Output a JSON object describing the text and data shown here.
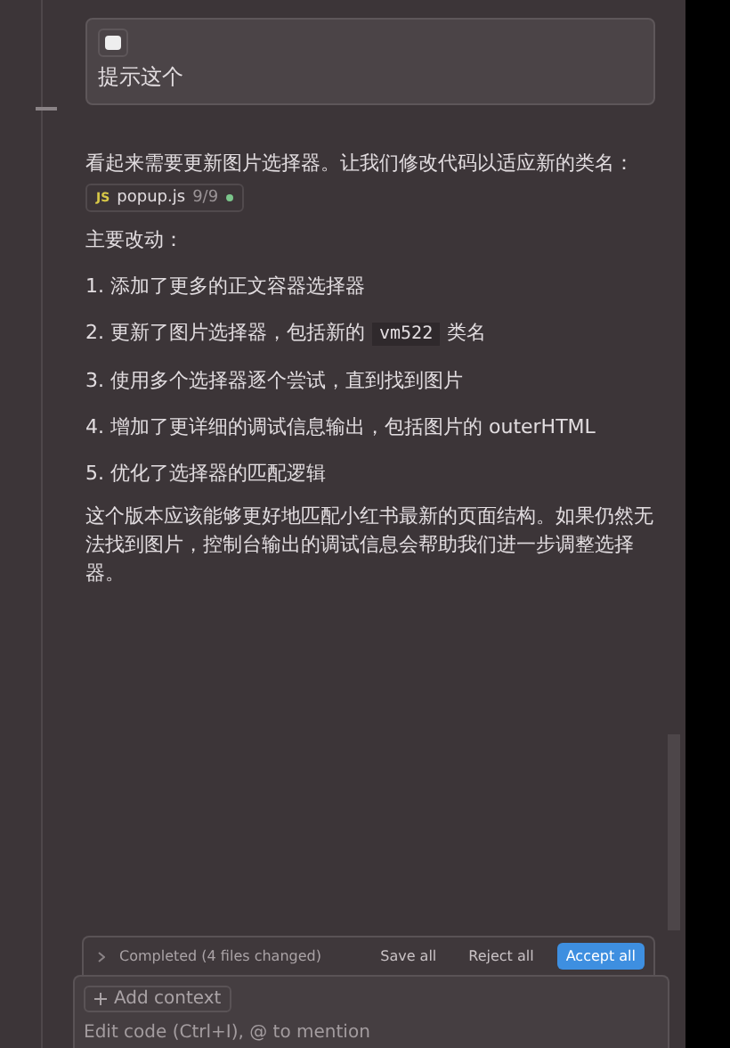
{
  "prompt_card": {
    "text": "提示这个"
  },
  "reply": {
    "intro": "看起来需要更新图片选择器。让我们修改代码以适应新的类名：",
    "file_chip": {
      "badge": "JS",
      "name": "popup.js",
      "count": "9/9"
    },
    "heading": "主要改动：",
    "changes": [
      {
        "number": "1.",
        "parts": [
          "添加了更多的正文容器选择器"
        ]
      },
      {
        "number": "2.",
        "parts": [
          "更新了图片选择器，包括新的",
          "vm522",
          "类名"
        ]
      },
      {
        "number": "3.",
        "parts": [
          "使用多个选择器逐个尝试，直到找到图片"
        ]
      },
      {
        "number": "4.",
        "parts": [
          "增加了更详细的调试信息输出，包括图片的 outerHTML"
        ]
      },
      {
        "number": "5.",
        "parts": [
          "优化了选择器的匹配逻辑"
        ]
      }
    ],
    "summary": "这个版本应该能够更好地匹配小红书最新的页面结构。如果仍然无法找到图片，控制台输出的调试信息会帮助我们进一步调整选择器。"
  },
  "changes_bar": {
    "status": "Completed (4 files changed)",
    "buttons": [
      {
        "label": "Save all",
        "kind": "plain"
      },
      {
        "label": "Reject all",
        "kind": "plain"
      },
      {
        "label": "Accept all",
        "kind": "primary"
      }
    ]
  },
  "composer": {
    "add_context": "Add context",
    "placeholder": "Edit code (Ctrl+I), @ to mention"
  }
}
